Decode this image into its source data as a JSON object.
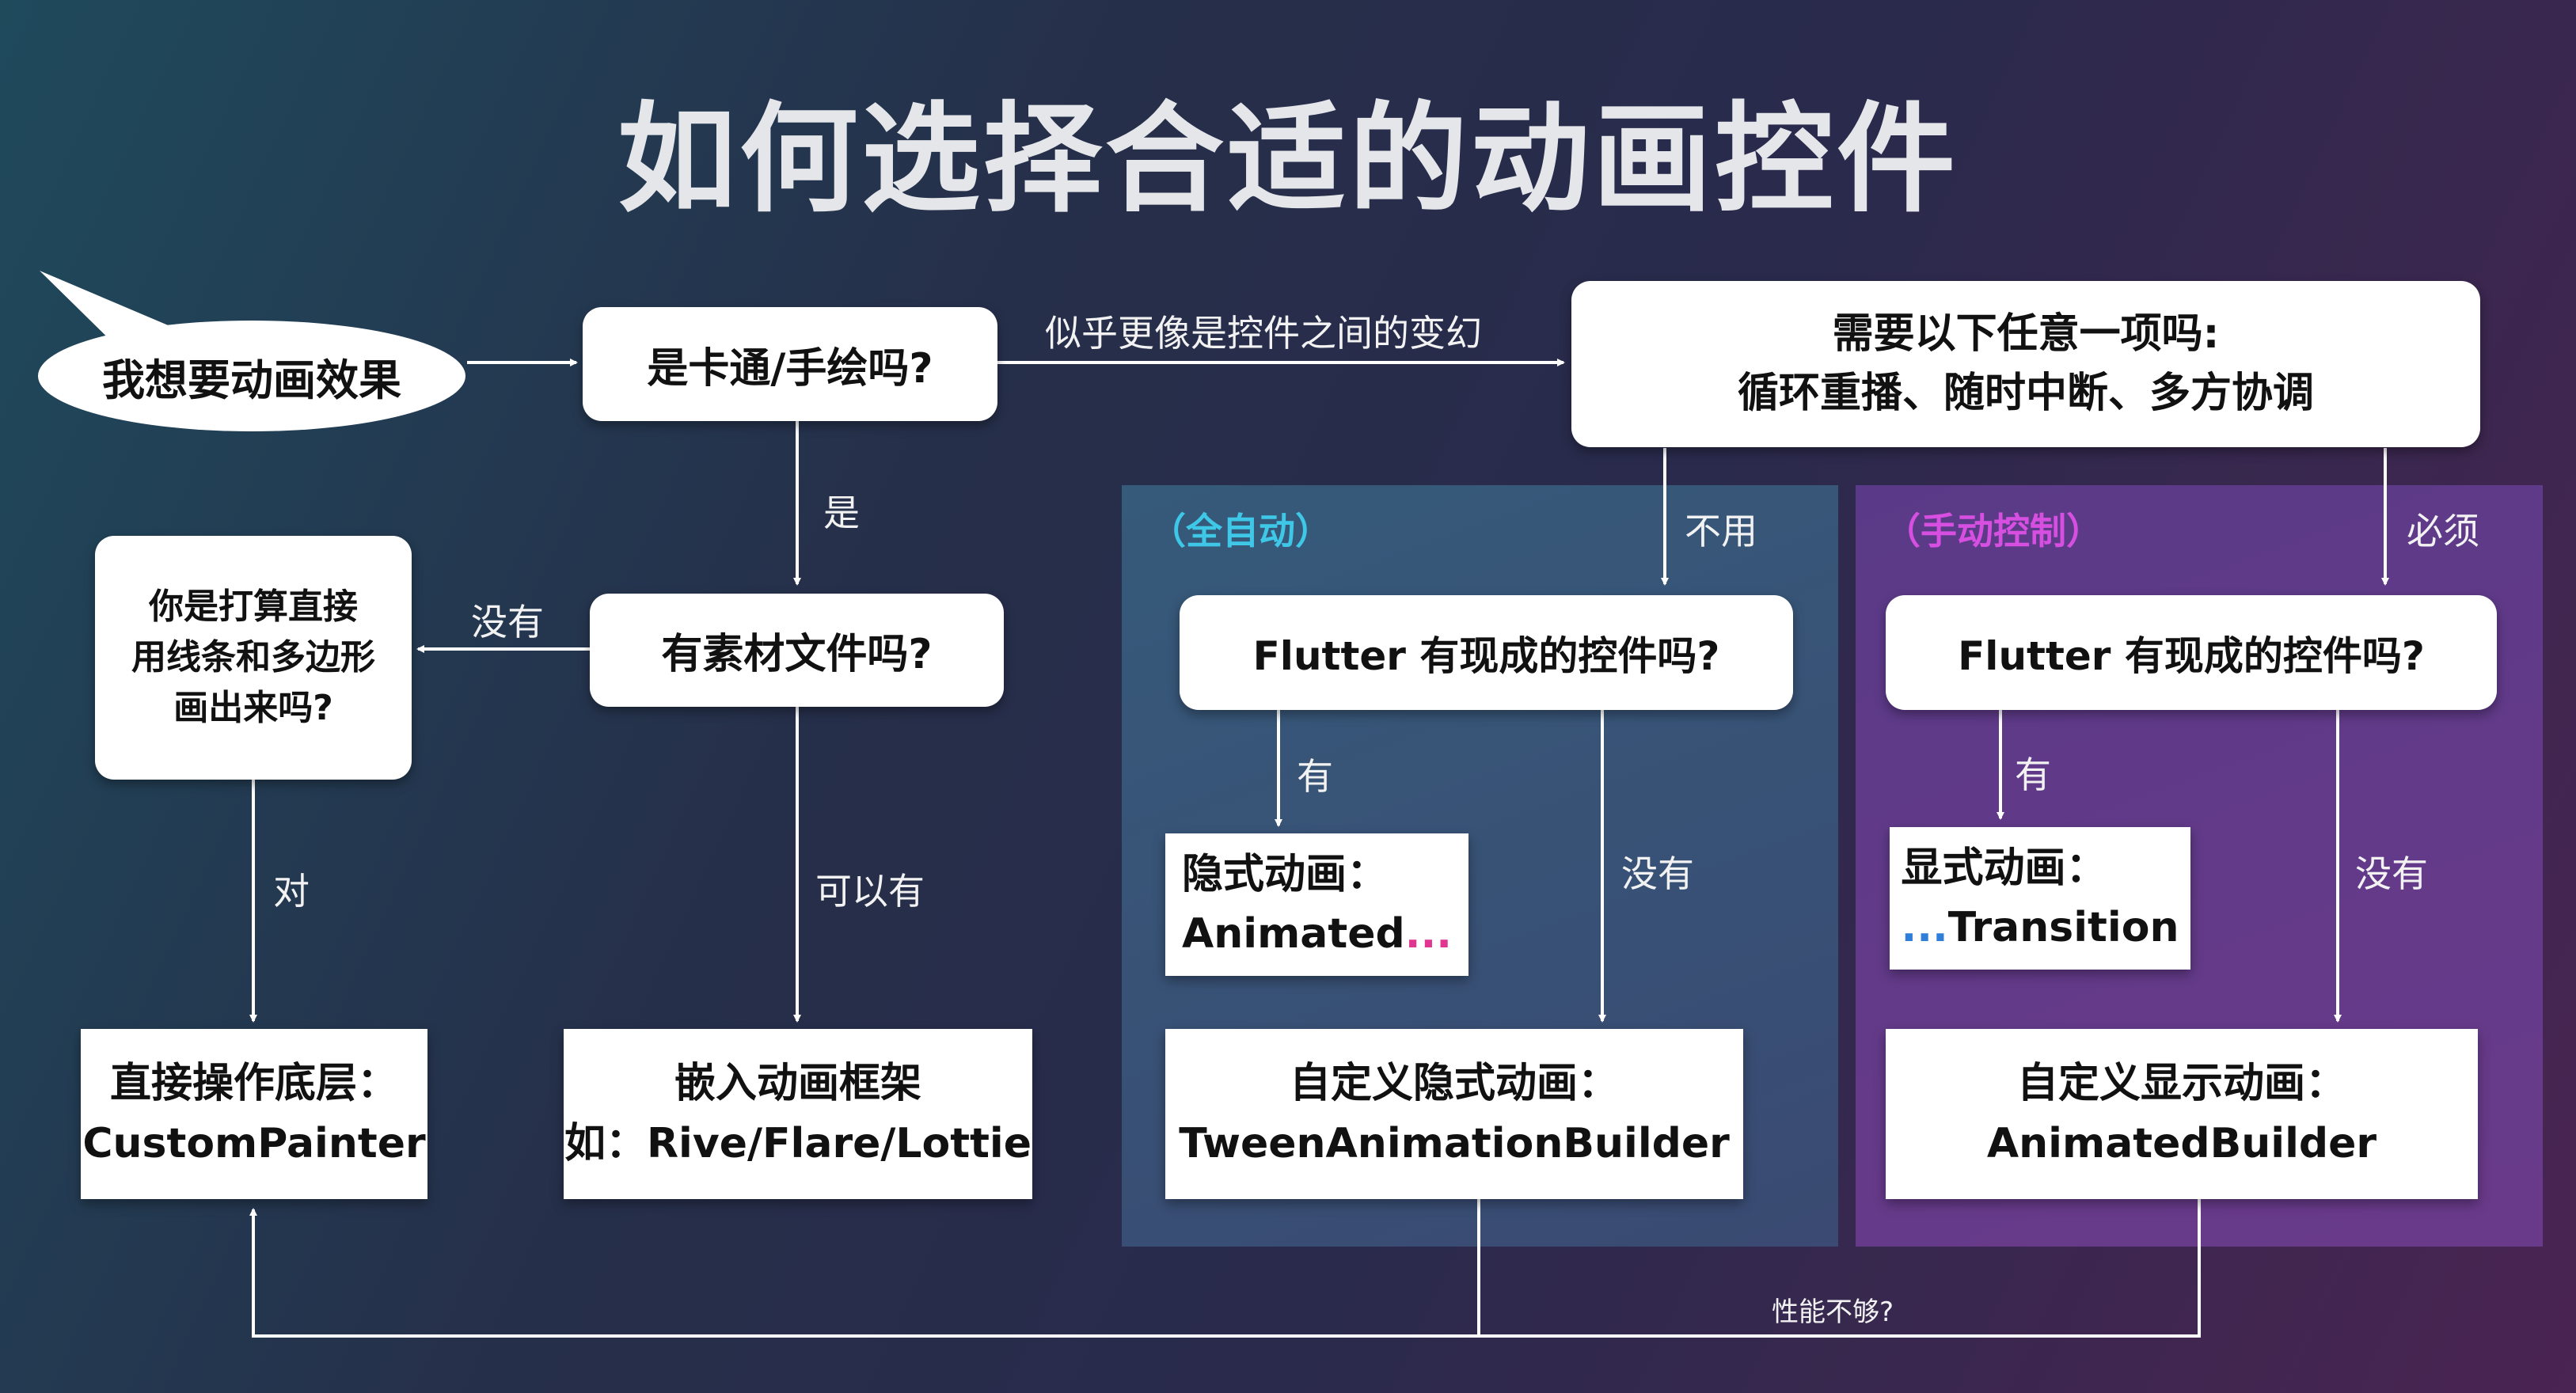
{
  "title": "如何选择合适的动画控件",
  "start": "我想要动画效果",
  "q_cartoon": "是卡通/手绘吗?",
  "q_any": {
    "line1": "需要以下任意一项吗:",
    "line2": "循环重播、随时中断、多方协调"
  },
  "q_asset": "有素材文件吗?",
  "q_draw": {
    "line1": "你是打算直接",
    "line2": "用线条和多边形",
    "line3": "画出来吗?"
  },
  "panels": {
    "auto": "（全自动）",
    "manual": "（手动控制）"
  },
  "q_flutter_auto": "Flutter 有现成的控件吗?",
  "q_flutter_manual": "Flutter 有现成的控件吗?",
  "implicit": {
    "line1": "隐式动画：",
    "prefix": "Animated",
    "dots": "..."
  },
  "explicit": {
    "line1": "显式动画：",
    "dots": "...",
    "suffix": "Transition"
  },
  "custom_painter": {
    "line1": "直接操作底层：",
    "line2": "CustomPainter"
  },
  "embed": {
    "line1": "嵌入动画框架",
    "line2": "如：Rive/Flare/Lottie"
  },
  "tween": {
    "line1": "自定义隐式动画：",
    "line2": "TweenAnimationBuilder"
  },
  "animated_builder": {
    "line1": "自定义显示动画：",
    "line2": "AnimatedBuilder"
  },
  "edges": {
    "looks_like_transform": "似乎更像是控件之间的变幻",
    "yes": "是",
    "no_asset": "没有",
    "right": "对",
    "maybe_yes": "可以有",
    "not_needed": "不用",
    "must": "必须",
    "has_auto": "有",
    "none_auto": "没有",
    "has_manual": "有",
    "none_manual": "没有",
    "perf": "性能不够?"
  },
  "colors": {
    "auto_label": "#3ec7e6",
    "manual_label": "#d64fe0",
    "dots_pink": "#e0368f",
    "dots_blue": "#2f7fd8"
  }
}
